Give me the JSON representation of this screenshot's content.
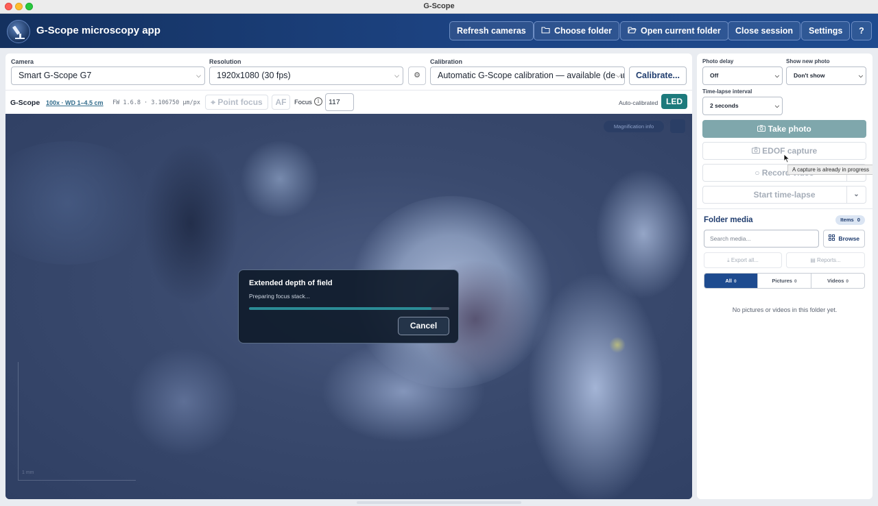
{
  "window": {
    "title": "G-Scope"
  },
  "header": {
    "app_title": "G-Scope microscopy app",
    "buttons": {
      "refresh": "Refresh cameras",
      "choose_folder": "Choose folder",
      "open_folder": "Open current folder",
      "close_session": "Close session",
      "settings": "Settings",
      "help": "?"
    }
  },
  "controls": {
    "camera_label": "Camera",
    "camera_value": "Smart G-Scope G7",
    "resolution_label": "Resolution",
    "resolution_value": "1920x1080 (30 fps)",
    "calibration_label": "Calibration",
    "calibration_value": "Automatic G-Scope calibration — available (default)",
    "calibrate_button": "Calibrate..."
  },
  "infobar": {
    "camera_name": "G-Scope",
    "magnification": "100x · WD 1–4.5 cm",
    "firmware": "FW 1.6.8 · 3.106750 µm/px",
    "point_focus": "Point focus",
    "af": "AF",
    "focus_label": "Focus",
    "focus_value": "117",
    "auto_calibrated": "Auto-calibrated",
    "led": "LED"
  },
  "viewer": {
    "tag": "Magnification info",
    "scale_label": "1 mm"
  },
  "modal": {
    "title": "Extended depth of field",
    "message": "Preparing focus stack...",
    "progress": 0.91,
    "cancel": "Cancel"
  },
  "capture": {
    "photo_delay_label": "Photo delay",
    "photo_delay_value": "Off",
    "show_new_photo_label": "Show new photo",
    "show_new_photo_value": "Don't show",
    "timelapse_interval_label": "Time-lapse interval",
    "timelapse_interval_value": "2 seconds",
    "take_photo": "Take photo",
    "edof_capture": "EDOF capture",
    "record_video": "Record video",
    "start_timelapse": "Start time-lapse",
    "tooltip": "A capture is already in progress"
  },
  "media": {
    "title": "Folder media",
    "items_label": "Items",
    "items_count": "0",
    "search_placeholder": "Search media...",
    "browse": "Browse",
    "export_all": "Export all...",
    "reports": "Reports...",
    "tabs": [
      {
        "label": "All",
        "count": "0"
      },
      {
        "label": "Pictures",
        "count": "0"
      },
      {
        "label": "Videos",
        "count": "0"
      }
    ],
    "empty_message": "No pictures or videos in this folder yet."
  },
  "colors": {
    "header": "#1d4484",
    "accent_teal": "#1d7a7c",
    "active_tab": "#1e4b8f"
  }
}
